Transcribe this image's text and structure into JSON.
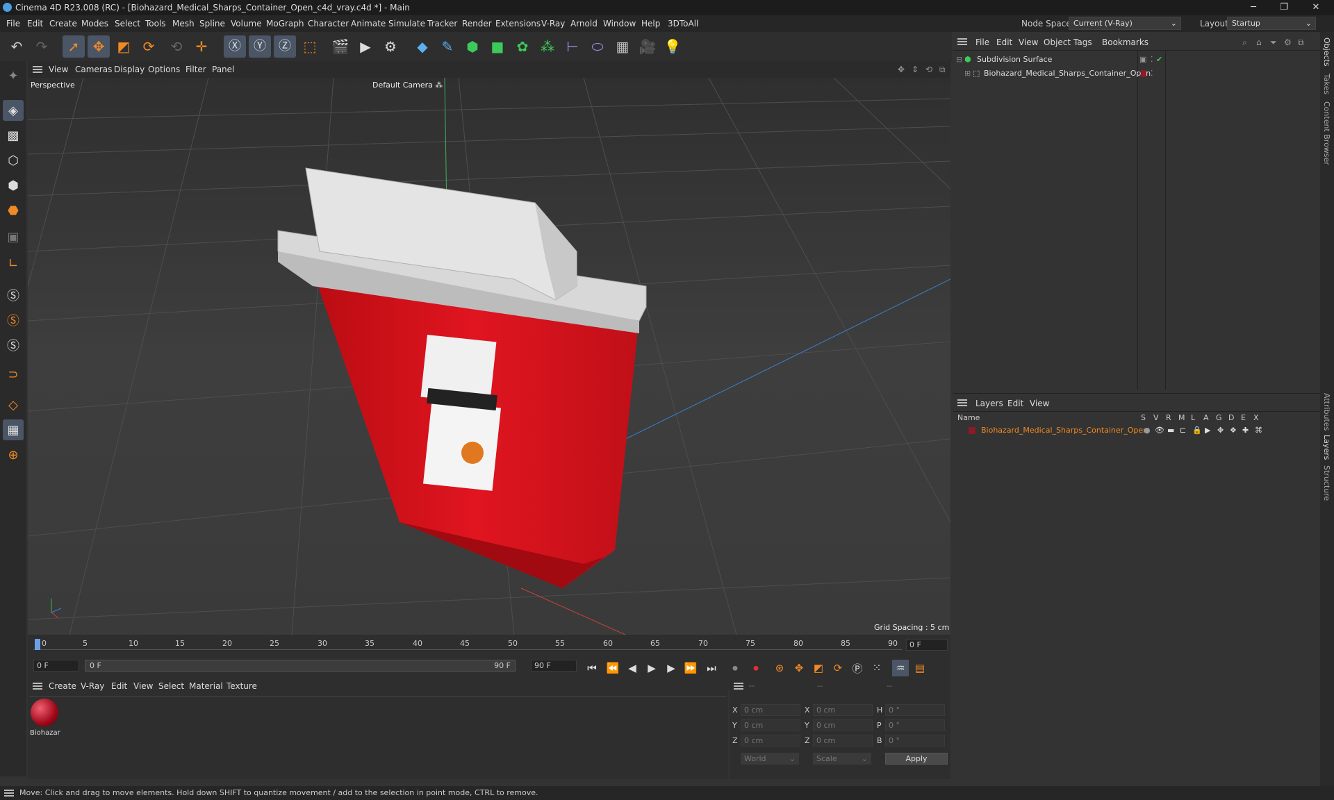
{
  "window": {
    "title": "Cinema 4D R23.008 (RC) - [Biohazard_Medical_Sharps_Container_Open_c4d_vray.c4d *] - Main",
    "minimize": "─",
    "restore": "❐",
    "close": "✕"
  },
  "menubar": {
    "items": [
      "File",
      "Edit",
      "Create",
      "Modes",
      "Select",
      "Tools",
      "Mesh",
      "Spline",
      "Volume",
      "MoGraph",
      "Character",
      "Animate",
      "Simulate",
      "Tracker",
      "Render",
      "Extensions",
      "V-Ray",
      "Arnold",
      "Window",
      "Help",
      "3DToAll"
    ],
    "node_space_label": "Node Space:",
    "node_space_value": "Current (V-Ray)",
    "layout_label": "Layout:",
    "layout_value": "Startup"
  },
  "viewport_menu": {
    "items": [
      "View",
      "Cameras",
      "Display",
      "Options",
      "Filter",
      "Panel"
    ]
  },
  "viewport": {
    "name": "Perspective",
    "camera": "Default Camera ⁂",
    "grid_spacing": "Grid Spacing : 5 cm"
  },
  "timeline": {
    "ticks": [
      "0",
      "5",
      "10",
      "15",
      "20",
      "25",
      "30",
      "35",
      "40",
      "45",
      "50",
      "55",
      "60",
      "65",
      "70",
      "75",
      "80",
      "85",
      "90"
    ],
    "current_frame": "0 F",
    "start_frame": "0 F",
    "range_start": "0 F",
    "range_end": "90 F",
    "end_frame": "90 F"
  },
  "material_menu": {
    "items": [
      "Create",
      "V-Ray",
      "Edit",
      "View",
      "Select",
      "Material",
      "Texture"
    ]
  },
  "material": {
    "name": "Biohazar"
  },
  "coordinates": {
    "header": [
      "--",
      "--",
      "--"
    ],
    "rows": [
      {
        "a": "X",
        "av": "0 cm",
        "b": "X",
        "bv": "0 cm",
        "c": "H",
        "cv": "0 °"
      },
      {
        "a": "Y",
        "av": "0 cm",
        "b": "Y",
        "bv": "0 cm",
        "c": "P",
        "cv": "0 °"
      },
      {
        "a": "Z",
        "av": "0 cm",
        "b": "Z",
        "bv": "0 cm",
        "c": "B",
        "cv": "0 °"
      }
    ],
    "mode": "World",
    "scale": "Scale",
    "apply": "Apply"
  },
  "object_manager": {
    "menu": [
      "File",
      "Edit",
      "View",
      "Object",
      "Tags",
      "Bookmarks"
    ],
    "objects": [
      {
        "name": "Subdivision Surface"
      },
      {
        "name": "Biohazard_Medical_Sharps_Container_Open"
      }
    ]
  },
  "layer_manager": {
    "menu": [
      "Layers",
      "Edit",
      "View"
    ],
    "columns": [
      "Name",
      "S",
      "V",
      "R",
      "M",
      "L",
      "A",
      "G",
      "D",
      "E",
      "X"
    ],
    "layers": [
      {
        "name": "Biohazard_Medical_Sharps_Container_Open",
        "color": "#8b1a2a"
      }
    ]
  },
  "side_tabs": [
    "Objects",
    "Takes",
    "Content Browser",
    "Attributes",
    "Layers",
    "Structure"
  ],
  "status": {
    "text": "Move: Click and drag to move elements. Hold down SHIFT to quantize movement / add to the selection in point mode, CTRL to remove."
  },
  "colors": {
    "accent": "#f08a24",
    "layer_text": "#f08a24",
    "selection": "#4a5566"
  }
}
